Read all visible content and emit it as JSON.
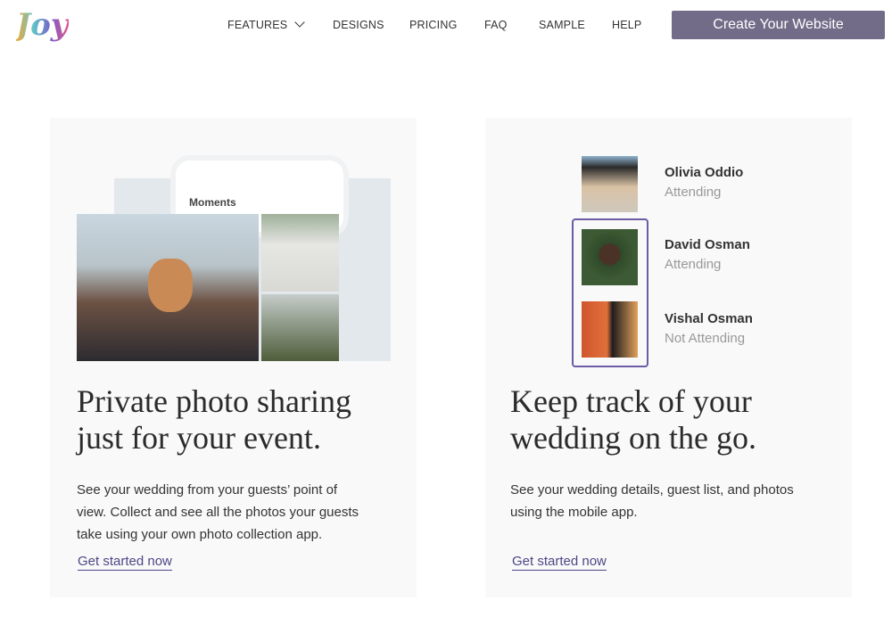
{
  "header": {
    "logo": "Joy",
    "nav": [
      {
        "label": "FEATURES"
      },
      {
        "label": "DESIGNS"
      },
      {
        "label": "PRICING"
      },
      {
        "label": "FAQ"
      },
      {
        "label": "SAMPLE"
      },
      {
        "label": "HELP"
      }
    ],
    "cta": "Create Your Website"
  },
  "cards": [
    {
      "app_label": "Moments",
      "title_line1": "Private photo sharing",
      "title_line2": "just for your event.",
      "body": [
        "See your wedding from your guests’ point of",
        "view. Collect and see all the photos your guests",
        "take using your own photo collection app."
      ],
      "link": "Get started now"
    },
    {
      "guests": [
        {
          "name": "Olivia Oddio",
          "status": "Attending"
        },
        {
          "name": "David Osman",
          "status": "Attending"
        },
        {
          "name": "Vishal Osman",
          "status": "Not Attending"
        }
      ],
      "title_line1": "Keep track of your",
      "title_line2": "wedding on the go.",
      "body": [
        "See your wedding details, guest list, and photos",
        "using the mobile app."
      ],
      "link": "Get started now"
    }
  ],
  "colors": {
    "accent": "#726c88",
    "link": "#4d4785",
    "highlight": "#6b5ca5"
  }
}
